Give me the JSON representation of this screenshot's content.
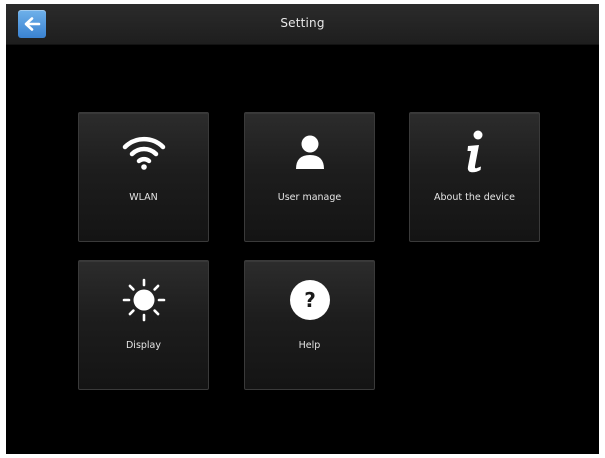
{
  "header": {
    "title": "Setting",
    "back_icon": "back-arrow-icon",
    "back_color": "#4a90d9"
  },
  "menu": {
    "tiles": [
      {
        "label": "WLAN",
        "icon": "wifi-icon"
      },
      {
        "label": "User manage",
        "icon": "user-icon"
      },
      {
        "label": "About the device",
        "icon": "info-icon"
      },
      {
        "label": "Display",
        "icon": "brightness-icon"
      },
      {
        "label": "Help",
        "icon": "help-icon"
      }
    ]
  }
}
